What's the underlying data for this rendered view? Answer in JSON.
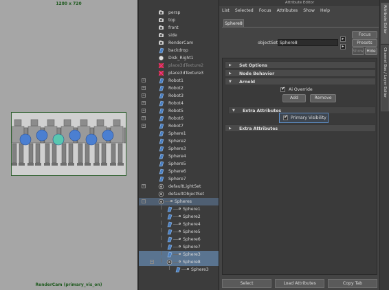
{
  "viewport": {
    "resolution": "1280 x 720",
    "camera_label": "RenderCam (primary_vis_on)"
  },
  "outliner": {
    "items": [
      {
        "label": "persp",
        "icon": "camera-icon"
      },
      {
        "label": "top",
        "icon": "camera-icon"
      },
      {
        "label": "front",
        "icon": "camera-icon"
      },
      {
        "label": "side",
        "icon": "camera-icon"
      },
      {
        "label": "RenderCam",
        "icon": "camera-icon"
      },
      {
        "label": "backdrop",
        "icon": "mesh-icon"
      },
      {
        "label": "Disk_Right1",
        "icon": "light-icon"
      },
      {
        "label": "place3dTexture2",
        "icon": "texture-placement-icon"
      },
      {
        "label": "place3dTexture3",
        "icon": "texture-placement-icon"
      },
      {
        "label": "Robot1",
        "icon": "mesh-icon"
      },
      {
        "label": "Robot2",
        "icon": "mesh-icon"
      },
      {
        "label": "Robot3",
        "icon": "mesh-icon"
      },
      {
        "label": "Robot4",
        "icon": "mesh-icon"
      },
      {
        "label": "Robot5",
        "icon": "mesh-icon"
      },
      {
        "label": "Robot6",
        "icon": "mesh-icon"
      },
      {
        "label": "Robot7",
        "icon": "mesh-icon"
      },
      {
        "label": "Sphere1",
        "icon": "mesh-icon"
      },
      {
        "label": "Sphere2",
        "icon": "mesh-icon"
      },
      {
        "label": "Sphere3",
        "icon": "mesh-icon"
      },
      {
        "label": "Sphere4",
        "icon": "mesh-icon"
      },
      {
        "label": "Sphere5",
        "icon": "mesh-icon"
      },
      {
        "label": "Sphere6",
        "icon": "mesh-icon"
      },
      {
        "label": "Sphere7",
        "icon": "mesh-icon"
      },
      {
        "label": "defaultLightSet",
        "icon": "set-icon"
      },
      {
        "label": "defaultObjectSet",
        "icon": "set-icon"
      },
      {
        "label": "Spheres",
        "icon": "set-icon"
      },
      {
        "label": "Sphere1",
        "icon": "mesh-icon"
      },
      {
        "label": "Sphere2",
        "icon": "mesh-icon"
      },
      {
        "label": "Sphere4",
        "icon": "mesh-icon"
      },
      {
        "label": "Sphere5",
        "icon": "mesh-icon"
      },
      {
        "label": "Sphere6",
        "icon": "mesh-icon"
      },
      {
        "label": "Sphere7",
        "icon": "mesh-icon"
      },
      {
        "label": "Sphere3",
        "icon": "mesh-icon"
      },
      {
        "label": "Sphere8",
        "icon": "set-icon"
      },
      {
        "label": "Sphere3",
        "icon": "mesh-icon"
      }
    ]
  },
  "attribute_editor": {
    "title": "Attribute Editor",
    "menu": [
      "List",
      "Selected",
      "Focus",
      "Attributes",
      "Show",
      "Help"
    ],
    "tab": "Sphere8",
    "object_set_label": "objectSet:",
    "object_set_value": "Sphere8",
    "focus_label": "Focus",
    "presets_label": "Presets",
    "show_label": "Show",
    "hide_label": "Hide",
    "sections": {
      "set_options": "Set Options",
      "node_behavior": "Node Behavior",
      "arnold": "Arnold",
      "extra_attributes_inner": "Extra Attributes",
      "extra_attributes": "Extra Attributes"
    },
    "ai_override_label": "Ai Override",
    "add_label": "Add",
    "remove_label": "Remove",
    "primary_visibility_label": "Primary Visibility",
    "bottom": {
      "select": "Select",
      "load_attributes": "Load Attributes",
      "copy_tab": "Copy Tab"
    }
  },
  "side_tabs": [
    "Attribute Editor",
    "Channel Box / Layer Editor"
  ]
}
